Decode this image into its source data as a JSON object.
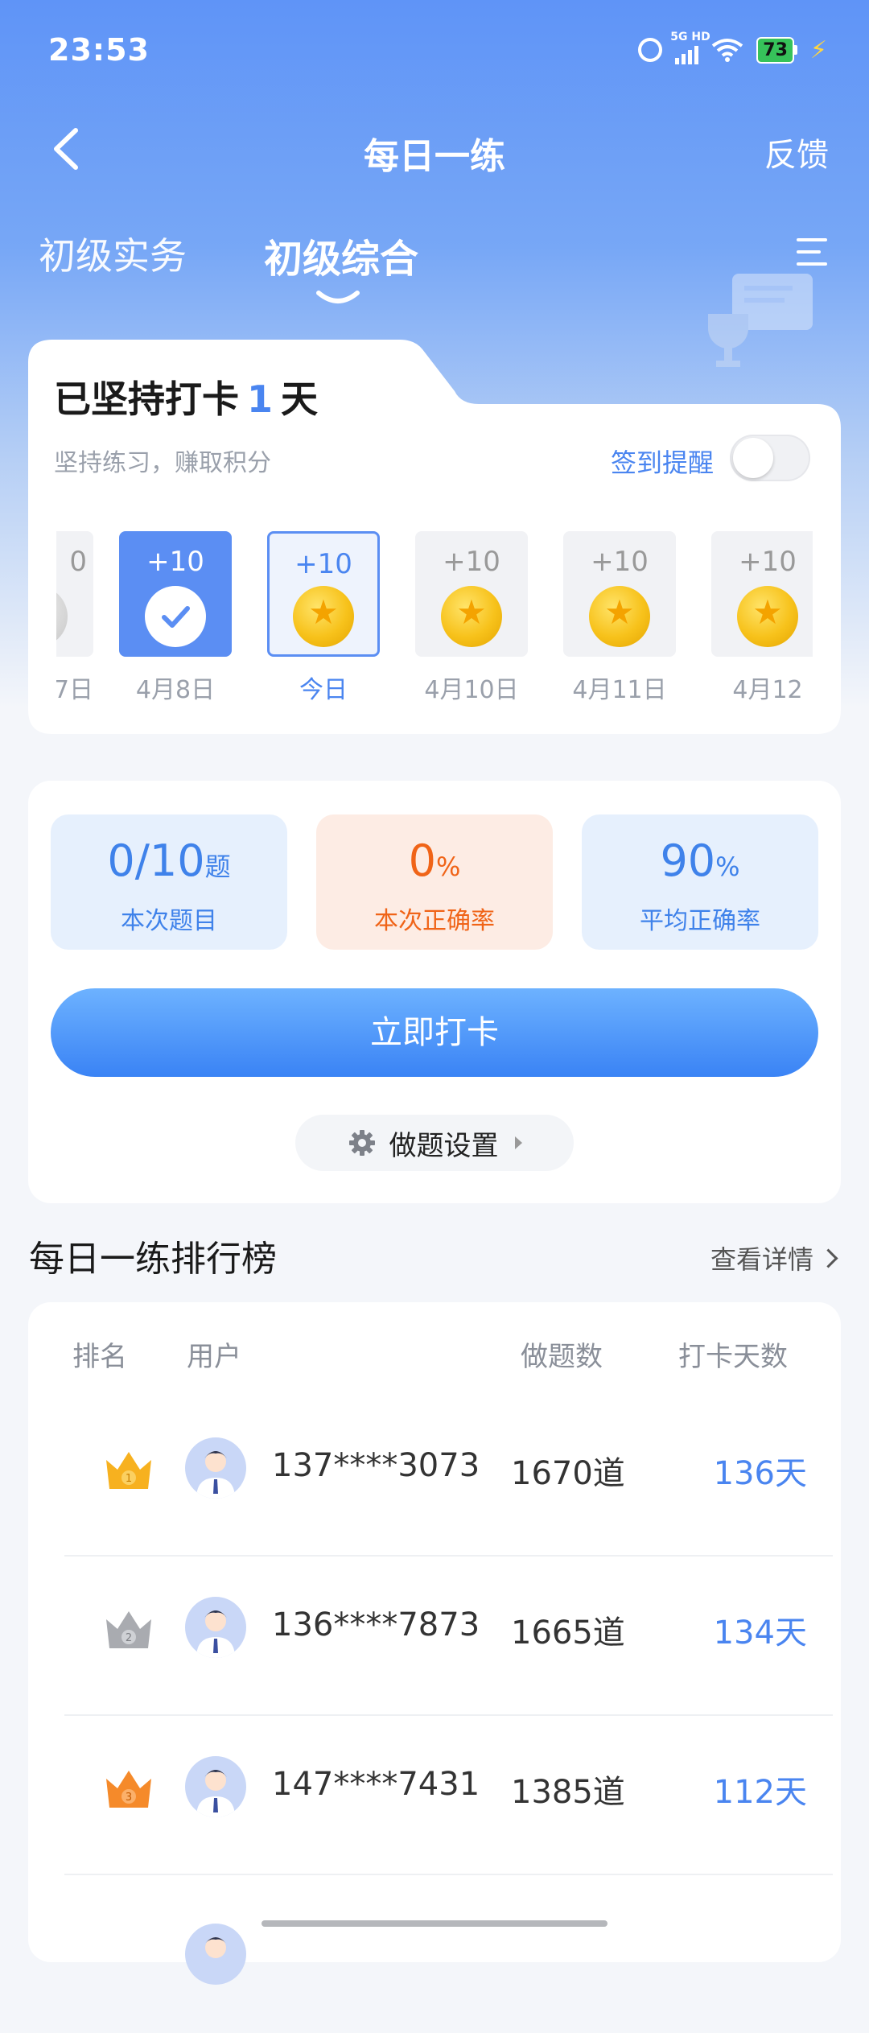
{
  "status_bar": {
    "time": "23:53",
    "network": "5G HD",
    "battery": "73"
  },
  "header": {
    "title": "每日一练",
    "feedback": "反馈"
  },
  "tabs": [
    {
      "label": "初级实务",
      "active": false
    },
    {
      "label": "初级综合",
      "active": true
    }
  ],
  "checkin": {
    "title_prefix": "已坚持打卡",
    "streak_days": "1",
    "title_suffix": "天",
    "subtitle": "坚持练习，赚取积分",
    "reminder_label": "签到提醒",
    "reminder_on": false,
    "days": [
      {
        "points": "0",
        "date": "7日",
        "state": "missed"
      },
      {
        "points": "+10",
        "date": "4月8日",
        "state": "done"
      },
      {
        "points": "+10",
        "date": "今日",
        "state": "today"
      },
      {
        "points": "+10",
        "date": "4月10日",
        "state": "future"
      },
      {
        "points": "+10",
        "date": "4月11日",
        "state": "future"
      },
      {
        "points": "+10",
        "date": "4月12",
        "state": "future"
      }
    ]
  },
  "stats": {
    "questions_value": "0/10",
    "questions_unit": "题",
    "questions_label": "本次题目",
    "accuracy_value": "0",
    "accuracy_unit": "%",
    "accuracy_label": "本次正确率",
    "avg_value": "90",
    "avg_unit": "%",
    "avg_label": "平均正确率",
    "checkin_button": "立即打卡",
    "settings_button": "做题设置"
  },
  "leaderboard": {
    "title": "每日一练排行榜",
    "more": "查看详情",
    "columns": {
      "rank": "排名",
      "user": "用户",
      "count": "做题数",
      "days": "打卡天数"
    },
    "rows": [
      {
        "rank": "1",
        "user": "137****3073",
        "count": "1670道",
        "days": "136天",
        "crown_color": "#f7b11f"
      },
      {
        "rank": "2",
        "user": "136****7873",
        "count": "1665道",
        "days": "134天",
        "crown_color": "#a9abb0"
      },
      {
        "rank": "3",
        "user": "147****7431",
        "count": "1385道",
        "days": "112天",
        "crown_color": "#f58a2a"
      }
    ]
  },
  "colors": {
    "accent": "#4a85f0",
    "orange": "#f06418"
  }
}
